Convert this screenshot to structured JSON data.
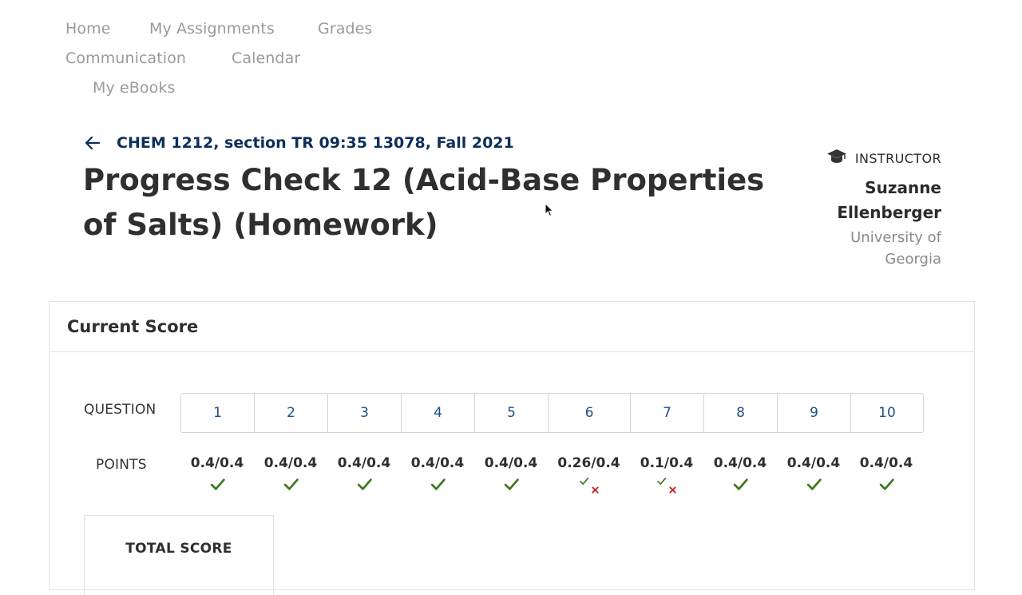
{
  "nav": {
    "items": [
      "Home",
      "My Assignments",
      "Grades",
      "Communication",
      "Calendar",
      "My eBooks"
    ]
  },
  "breadcrumb": {
    "course": "CHEM 1212, section TR 09:35 13078, Fall 2021"
  },
  "title": "Progress Check 12 (Acid-Base Properties of Salts) (Homework)",
  "instructor": {
    "role": "INSTRUCTOR",
    "name": "Suzanne Ellenberger",
    "school": "University of Georgia"
  },
  "score": {
    "header": "Current Score",
    "question_label": "QUESTION",
    "points_label": "POINTS",
    "total_label": "TOTAL SCORE",
    "questions": [
      {
        "num": "1",
        "points": "0.4/0.4",
        "status": "correct"
      },
      {
        "num": "2",
        "points": "0.4/0.4",
        "status": "correct"
      },
      {
        "num": "3",
        "points": "0.4/0.4",
        "status": "correct"
      },
      {
        "num": "4",
        "points": "0.4/0.4",
        "status": "correct"
      },
      {
        "num": "5",
        "points": "0.4/0.4",
        "status": "correct"
      },
      {
        "num": "6",
        "points": "0.26/0.4",
        "status": "partial"
      },
      {
        "num": "7",
        "points": "0.1/0.4",
        "status": "partial"
      },
      {
        "num": "8",
        "points": "0.4/0.4",
        "status": "correct"
      },
      {
        "num": "9",
        "points": "0.4/0.4",
        "status": "correct"
      },
      {
        "num": "10",
        "points": "0.4/0.4",
        "status": "correct"
      }
    ]
  },
  "colors": {
    "correct": "#3d7a1f",
    "incorrect": "#c0262d",
    "link": "#0d2f5a",
    "question_number": "#1f4f86"
  }
}
